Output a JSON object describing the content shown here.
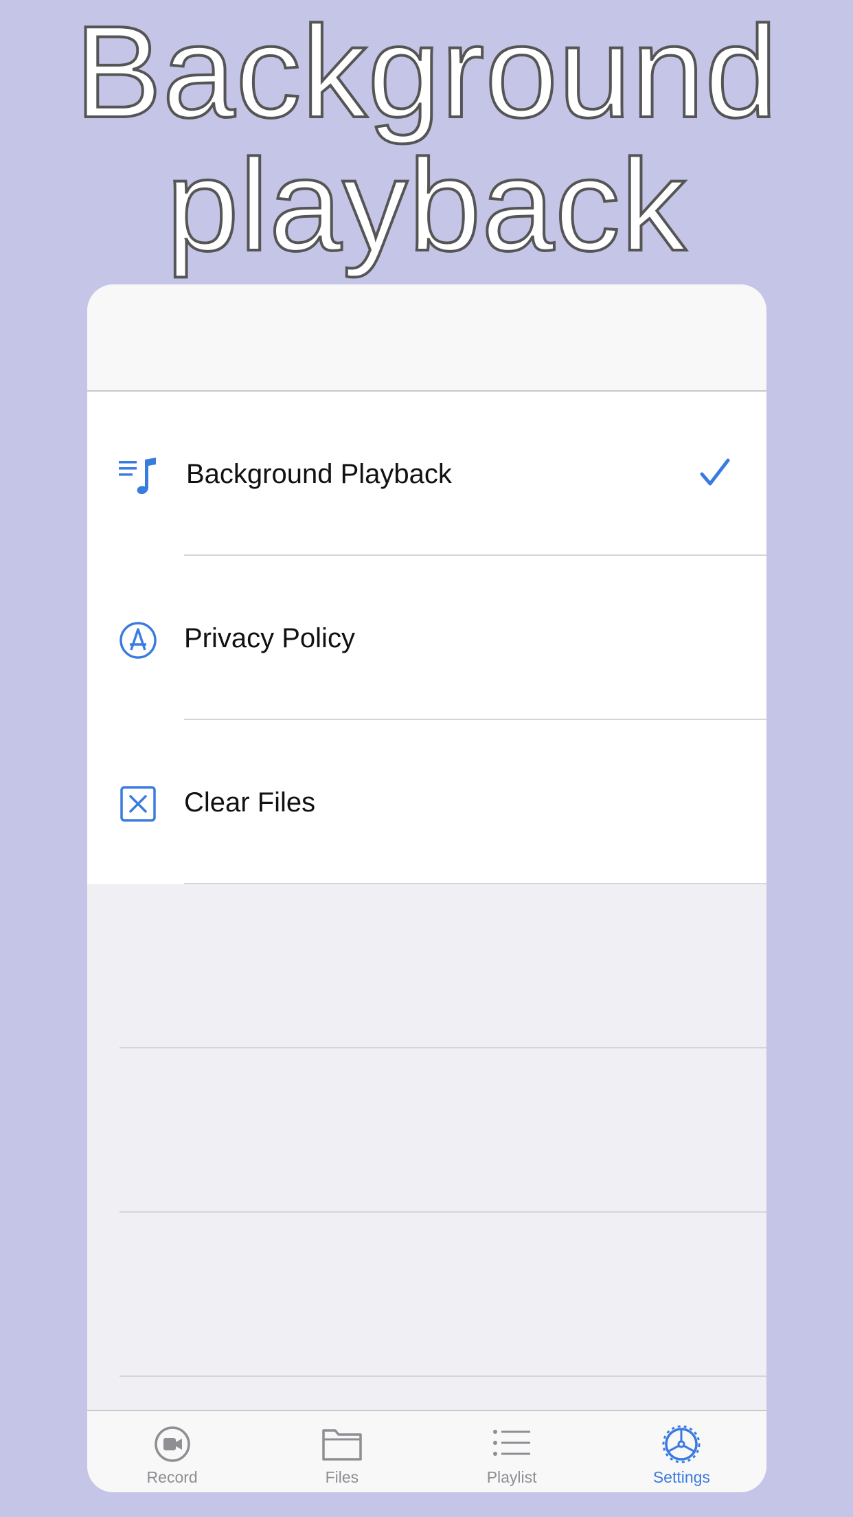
{
  "headline": {
    "line1": "Background",
    "line2": "playback"
  },
  "settings": {
    "rows": [
      {
        "label": "Background Playback",
        "icon": "music-list-icon",
        "checked": true
      },
      {
        "label": "Privacy Policy",
        "icon": "app-store-icon",
        "checked": false
      },
      {
        "label": "Clear Files",
        "icon": "clear-box-icon",
        "checked": false
      }
    ]
  },
  "tabbar": {
    "tabs": [
      {
        "label": "Record",
        "icon": "record-icon",
        "active": false
      },
      {
        "label": "Files",
        "icon": "folder-icon",
        "active": false
      },
      {
        "label": "Playlist",
        "icon": "list-icon",
        "active": false
      },
      {
        "label": "Settings",
        "icon": "gear-icon",
        "active": true
      }
    ]
  },
  "colors": {
    "background": "#c5c5e7",
    "accent": "#3a7be0",
    "inactive": "#8e8e93"
  }
}
